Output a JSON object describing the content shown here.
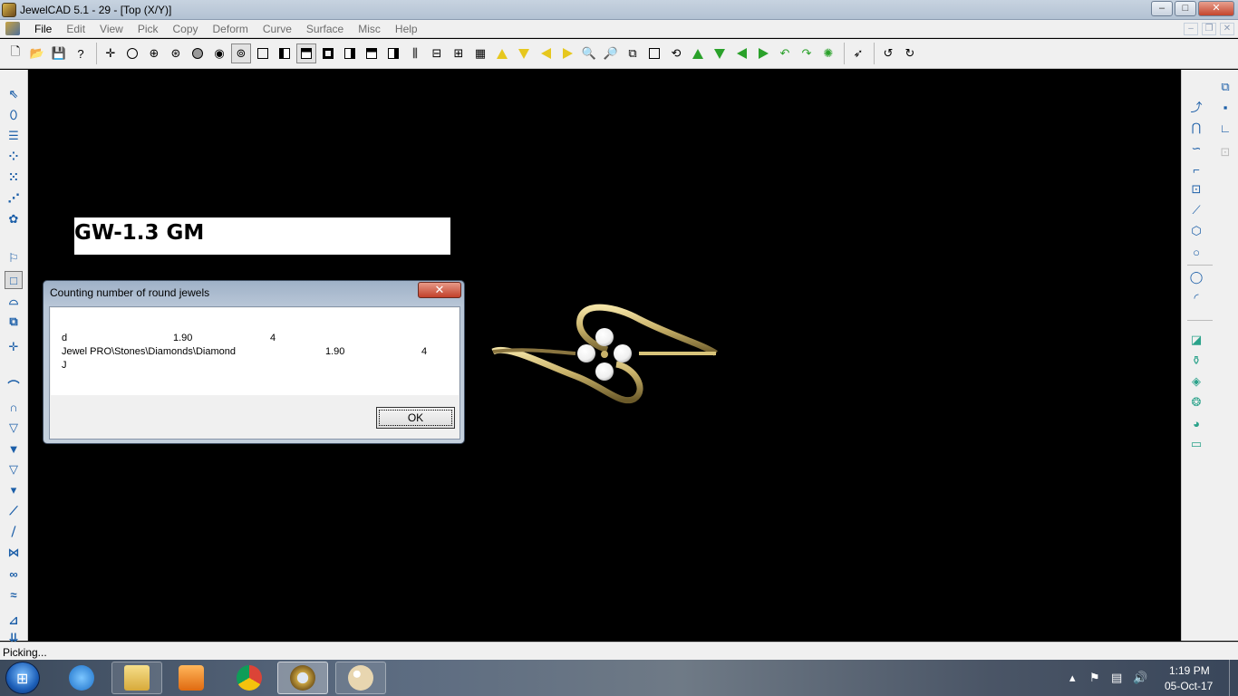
{
  "window": {
    "title": "JewelCAD 5.1 - 29 - [Top (X/Y)]",
    "minimize": "–",
    "maximize": "□",
    "close": "✕"
  },
  "menu": {
    "items": [
      "File",
      "Edit",
      "View",
      "Pick",
      "Copy",
      "Deform",
      "Curve",
      "Surface",
      "Misc",
      "Help"
    ],
    "mdi_minimize": "–",
    "mdi_restore": "❐",
    "mdi_close": "✕"
  },
  "canvas": {
    "background": "#000000",
    "label_text": "GW-1.3 GM"
  },
  "dialog": {
    "title": "Counting number of round jewels",
    "close_label": "✕",
    "rows": [
      {
        "name": "d",
        "size": "1.90",
        "count": "4"
      },
      {
        "name": "Jewel PRO\\Stones\\Diamonds\\Diamond",
        "size": "1.90",
        "count": "4"
      },
      {
        "name": "J",
        "size": "",
        "count": ""
      }
    ],
    "ok_label": "OK"
  },
  "status": {
    "text": "Picking..."
  },
  "taskbar": {
    "apps": [
      "windows-explorer",
      "internet-explorer",
      "file-explorer",
      "media-player",
      "chrome",
      "jewelcad",
      "paint"
    ],
    "time": "1:19 PM",
    "date": "05-Oct-17"
  },
  "colors": {
    "ring_gold": "#c9b26a",
    "diamond": "#f2f2f2",
    "accent_blue": "#1b5ea8",
    "close_red": "#c4452c"
  }
}
